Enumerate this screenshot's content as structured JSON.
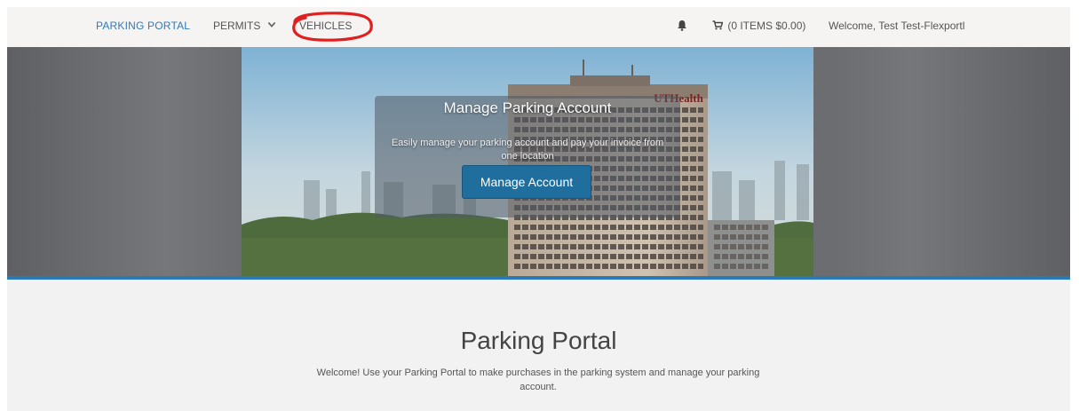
{
  "nav": {
    "brand": "PARKING PORTAL",
    "permits": "PERMITS",
    "vehicles": "VEHICLES",
    "cart": "(0 ITEMS $0.00)",
    "welcome": "Welcome, Test Test-Flexportl"
  },
  "icons": {
    "permits_dropdown": "chevron-down-icon",
    "notifications": "bell-icon",
    "cart": "cart-icon"
  },
  "hero": {
    "title": "Manage Parking Account",
    "text": "Easily manage your parking account and pay your invoice from one location",
    "button": "Manage Account",
    "sign": "UTHealth"
  },
  "main": {
    "title": "Parking Portal",
    "intro": "Welcome! Use your Parking Portal to make purchases in the parking system and manage your parking account."
  },
  "colors": {
    "link": "#337ab7",
    "button": "#1f6e9e",
    "accent_border": "#2a7ab8",
    "annotation": "#e02020"
  }
}
